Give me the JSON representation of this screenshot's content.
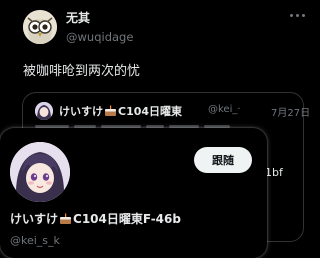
{
  "tweet": {
    "author_name": "无其",
    "author_handle": "@wuqidage",
    "text": "被咖啡呛到两次的忧",
    "more_icon": "more-horizontal-icon"
  },
  "quote": {
    "name_prefix": "けいすけ",
    "name_suffix": "C104日曜東",
    "handle": "@kei_·",
    "date": "7月27日",
    "tail_text": "1bf"
  },
  "hovercard": {
    "name_prefix": "けいすけ",
    "name_suffix": "C104日曜東F-46b",
    "handle": "@kei_s_k",
    "follow_label": "跟随"
  }
}
